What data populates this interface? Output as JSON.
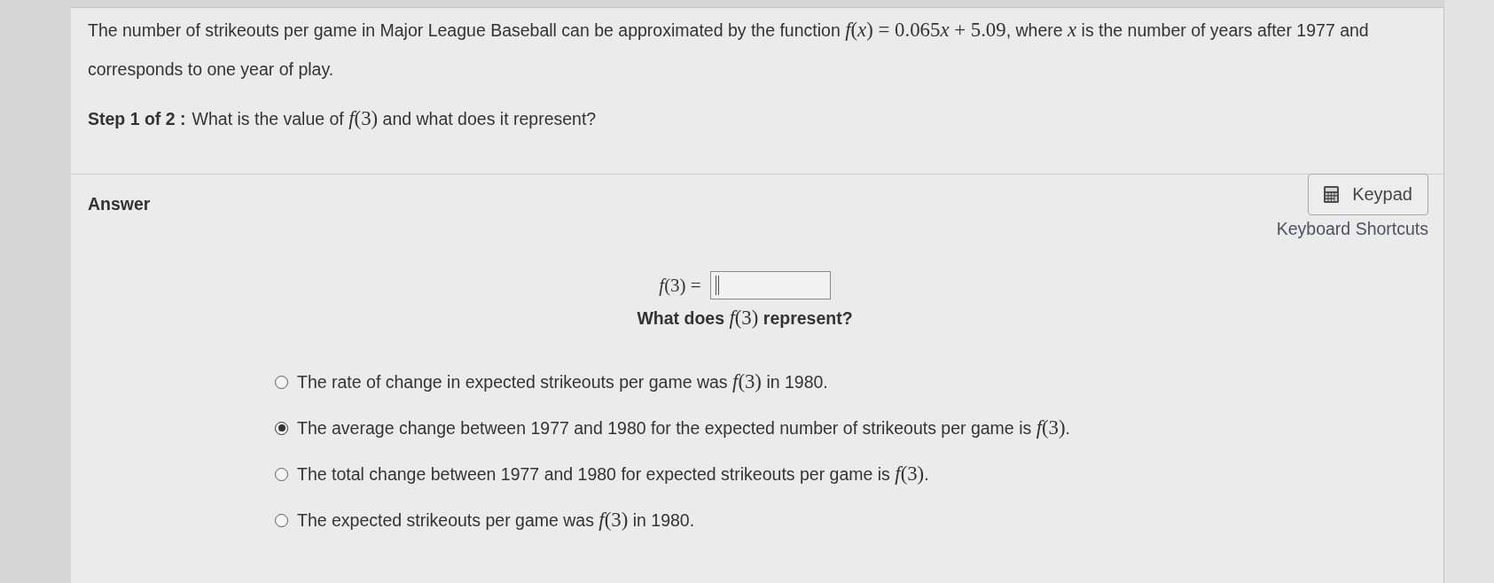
{
  "question": {
    "text": [
      {
        "kind": "text",
        "text": "The number of strikeouts per game in Major League Baseball can be approximated by the function "
      },
      {
        "kind": "math",
        "text": "*f*(*x*) = 0.065"
      },
      {
        "kind": "math",
        "text": "*x* + 5.09"
      },
      {
        "kind": "text",
        "text": ", where "
      },
      {
        "kind": "math",
        "text": "*x*"
      },
      {
        "kind": "text",
        "text": " is the number of years after 1977 and corresponds to one year of play."
      }
    ]
  },
  "step": {
    "label": "Step 1 of 2 :",
    "prompt": [
      {
        "kind": "text",
        "text": "What is the value of "
      },
      {
        "kind": "math",
        "text": "*f*(3)"
      },
      {
        "kind": "text",
        "text": " and what does it represent?"
      }
    ]
  },
  "answer": {
    "label": "Answer",
    "keypad_button": "Keypad",
    "shortcuts_link": "Keyboard Shortcuts",
    "equation": {
      "label": "*f*(3) =",
      "field": {
        "focused": true
      }
    },
    "question": [
      {
        "kind": "text",
        "text": "What does "
      },
      {
        "kind": "math",
        "text": "*f*(3)"
      },
      {
        "kind": "text",
        "text": " represent?"
      }
    ],
    "options": [
      {
        "selected": false,
        "text": [
          {
            "kind": "text",
            "text": "The rate of change in expected strikeouts per game was "
          },
          {
            "kind": "math",
            "text": "*f*(3)"
          },
          {
            "kind": "text",
            "text": " in 1980."
          }
        ]
      },
      {
        "selected": true,
        "text": [
          {
            "kind": "text",
            "text": "The average change between 1977 and 1980 for the expected number of strikeouts per game is "
          },
          {
            "kind": "math",
            "text": "*f*(3)"
          },
          {
            "kind": "text",
            "text": "."
          }
        ]
      },
      {
        "selected": false,
        "text": [
          {
            "kind": "text",
            "text": "The total change between 1977 and 1980 for expected strikeouts per game is "
          },
          {
            "kind": "math",
            "text": "*f*(3)"
          },
          {
            "kind": "text",
            "text": "."
          }
        ]
      },
      {
        "selected": false,
        "text": [
          {
            "kind": "text",
            "text": "The expected strikeouts per game was "
          },
          {
            "kind": "math",
            "text": "*f*(3)"
          },
          {
            "kind": "text",
            "text": " in 1980."
          }
        ]
      }
    ]
  }
}
